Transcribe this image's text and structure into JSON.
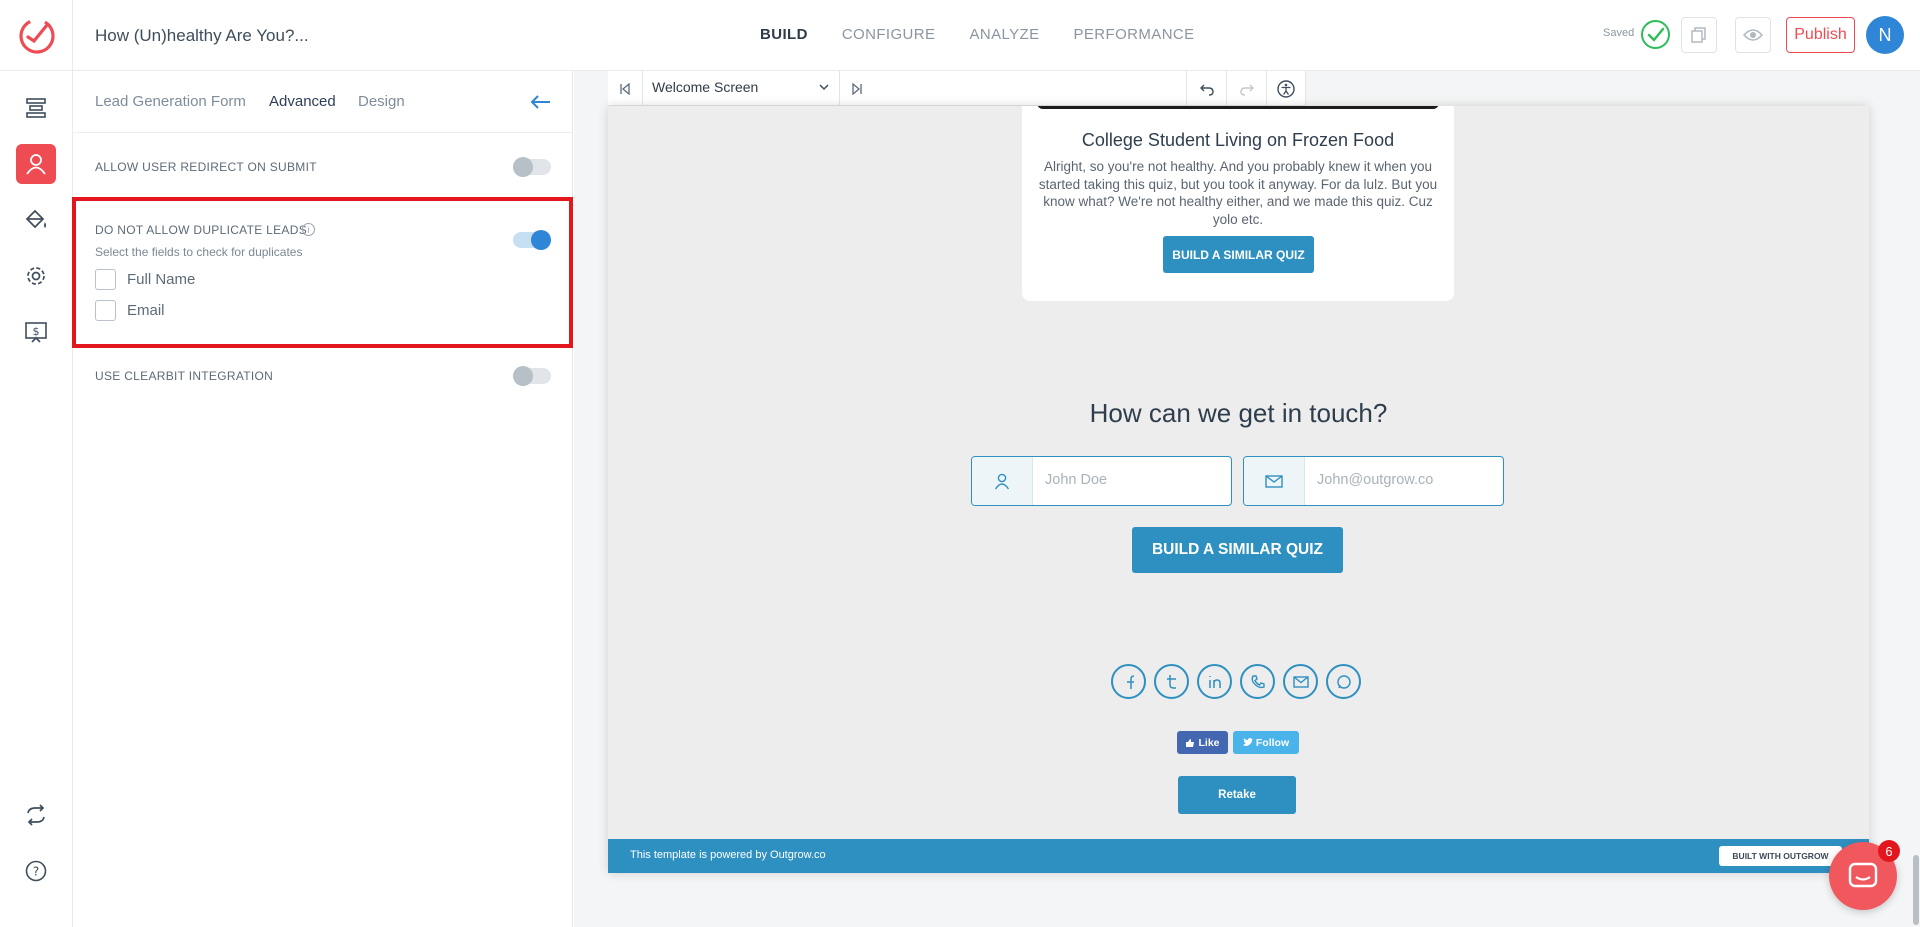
{
  "header": {
    "doc_title": "How (Un)healthy Are You?...",
    "nav": [
      "BUILD",
      "CONFIGURE",
      "ANALYZE",
      "PERFORMANCE"
    ],
    "active_nav": "BUILD",
    "saved_label": "Saved",
    "publish_label": "Publish",
    "avatar_initial": "N"
  },
  "rail": {
    "items": [
      "layout-icon",
      "user-icon",
      "paint-bucket-icon",
      "gear-icon",
      "pricing-icon"
    ],
    "active": "user-icon",
    "bottom": [
      "sync-icon",
      "help-icon"
    ]
  },
  "panel": {
    "tabs": [
      "Lead Generation Form",
      "Advanced",
      "Design"
    ],
    "active_tab": "Advanced",
    "redirect_label": "ALLOW USER REDIRECT ON SUBMIT",
    "redirect_on": false,
    "duplicate_label": "DO NOT ALLOW DUPLICATE LEADS",
    "duplicate_sub": "Select the fields to check for duplicates",
    "duplicate_on": true,
    "dup_fields": [
      {
        "label": "Full Name",
        "checked": false
      },
      {
        "label": "Email",
        "checked": false
      }
    ],
    "clearbit_label": "USE CLEARBIT INTEGRATION",
    "clearbit_on": false
  },
  "toolbar": {
    "screen": "Welcome Screen"
  },
  "preview": {
    "result_title": "College Student Living on Frozen Food",
    "result_desc": "Alright, so you're not healthy. And you probably knew it when you started taking this quiz, but you took it anyway. For da lulz. But you know what? We're not healthy either, and we made this quiz. Cuz yolo etc.",
    "small_cta": "BUILD A SIMILAR QUIZ",
    "touch_heading": "How can we get in touch?",
    "name_placeholder": "John Doe",
    "email_placeholder": "John@outgrow.co",
    "big_cta": "BUILD A SIMILAR QUIZ",
    "socials": [
      "facebook-icon",
      "twitter-icon",
      "linkedin-icon",
      "phone-icon",
      "mail-icon",
      "whatsapp-icon"
    ],
    "like_label": "Like",
    "follow_label": "Follow",
    "retake_label": "Retake",
    "footer_text": "This template is powered by Outgrow.co",
    "built_badge": "BUILT WITH OUTGROW"
  },
  "chat": {
    "badge": "6"
  },
  "colors": {
    "accent": "#2e90c0",
    "brand": "#ee4b53",
    "highlight": "#e4161d",
    "toggle_on": "#2f86d6"
  }
}
